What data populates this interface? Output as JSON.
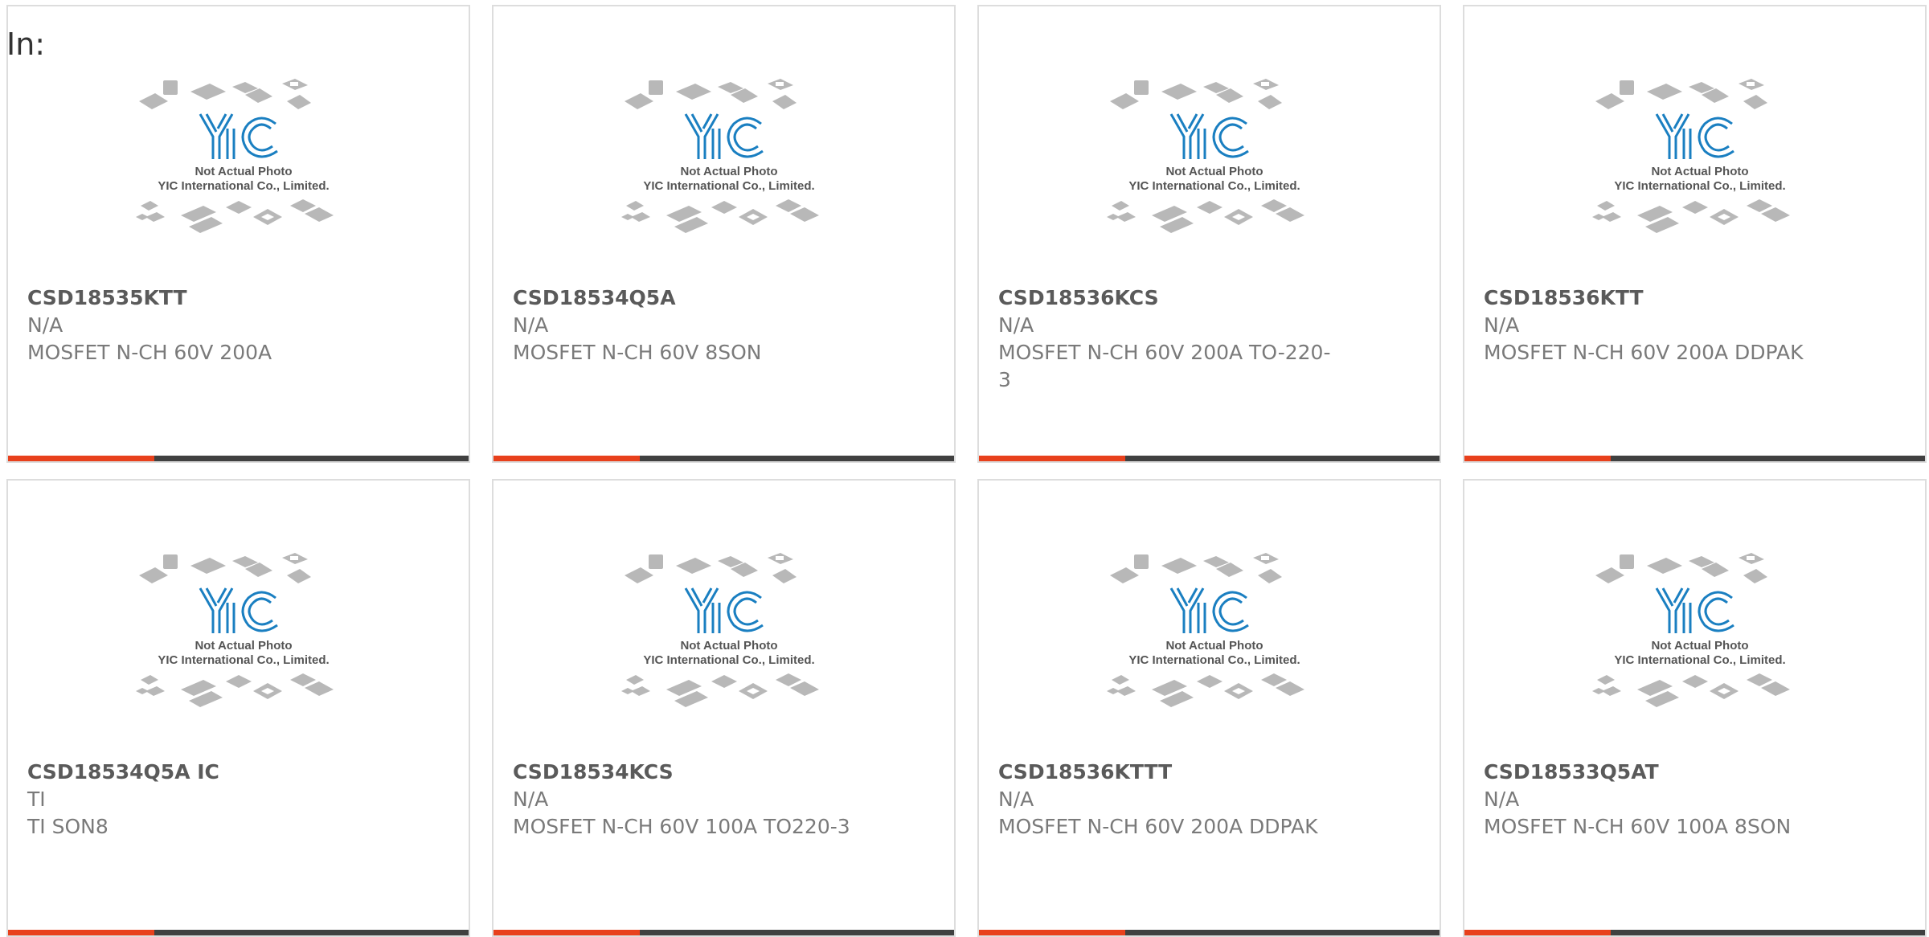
{
  "header": {
    "label": "In:"
  },
  "placeholder": {
    "caption_line1": "Not Actual Photo",
    "caption_line2": "YIC International Co., Limited.",
    "logo_text": "YIC"
  },
  "colors": {
    "accent": "#e8401c",
    "bar": "#404040",
    "text": "#7a7a7a",
    "logo": "#1a7fc1"
  },
  "products": [
    {
      "part": "CSD18535KTT",
      "manufacturer": "N/A",
      "description": "MOSFET N-CH 60V 200A"
    },
    {
      "part": "CSD18534Q5A",
      "manufacturer": "N/A",
      "description": "MOSFET N-CH 60V 8SON"
    },
    {
      "part": "CSD18536KCS",
      "manufacturer": "N/A",
      "description": "MOSFET N-CH 60V 200A TO-220-3"
    },
    {
      "part": "CSD18536KTT",
      "manufacturer": "N/A",
      "description": "MOSFET N-CH 60V 200A DDPAK"
    },
    {
      "part": "CSD18534Q5A IC",
      "manufacturer": "TI",
      "description": "TI SON8"
    },
    {
      "part": "CSD18534KCS",
      "manufacturer": "N/A",
      "description": "MOSFET N-CH 60V 100A TO220-3"
    },
    {
      "part": "CSD18536KTTT",
      "manufacturer": "N/A",
      "description": "MOSFET N-CH 60V 200A DDPAK"
    },
    {
      "part": "CSD18533Q5AT",
      "manufacturer": "N/A",
      "description": "MOSFET N-CH 60V 100A 8SON"
    }
  ]
}
